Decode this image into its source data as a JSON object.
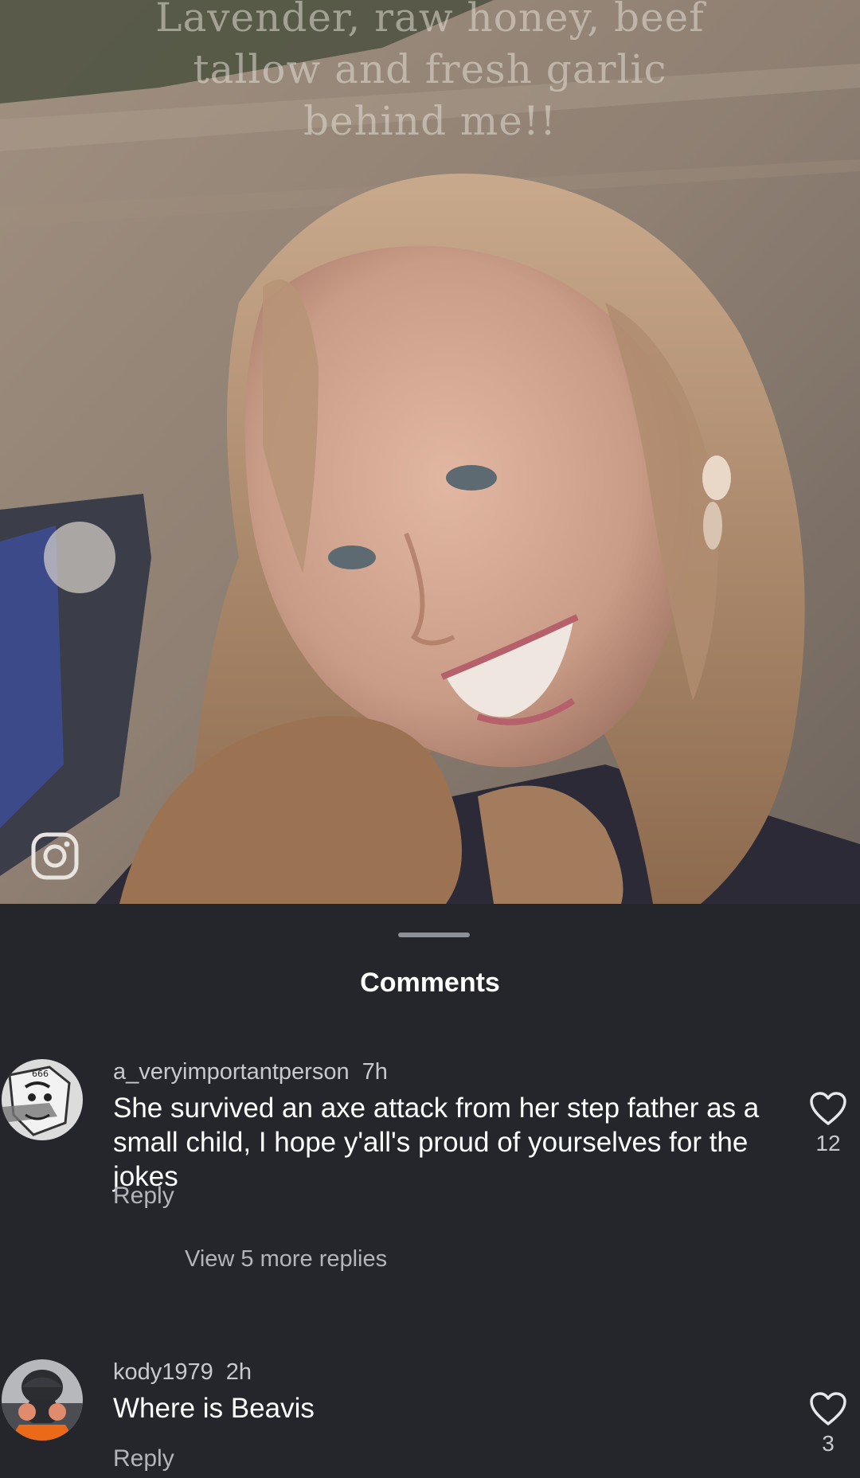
{
  "post": {
    "caption_lines": [
      "Lavender, raw honey, beef",
      "tallow and fresh garlic",
      "behind me!!"
    ],
    "watermark_icon": "instagram-icon"
  },
  "comments_sheet": {
    "title": "Comments",
    "comments": [
      {
        "username": "a_veryimportantperson",
        "time": "7h",
        "text": "She survived an axe attack from her step father as a small child, I hope y'all's proud of yourselves for the jokes",
        "reply_label": "Reply",
        "like_count": "12",
        "view_replies": "View 5 more replies",
        "avatar_icon": "manga-avatar-icon",
        "avatar_text": "666"
      },
      {
        "username": "kody1979",
        "time": "2h",
        "text": "Where is Beavis",
        "reply_label": "Reply",
        "like_count": "3",
        "avatar_icon": "respirator-avatar-icon"
      }
    ]
  },
  "colors": {
    "sheet_background": "#24262b",
    "primary_text": "#ffffff",
    "secondary_text": "#b3b5ba",
    "handle": "#8e9097"
  }
}
